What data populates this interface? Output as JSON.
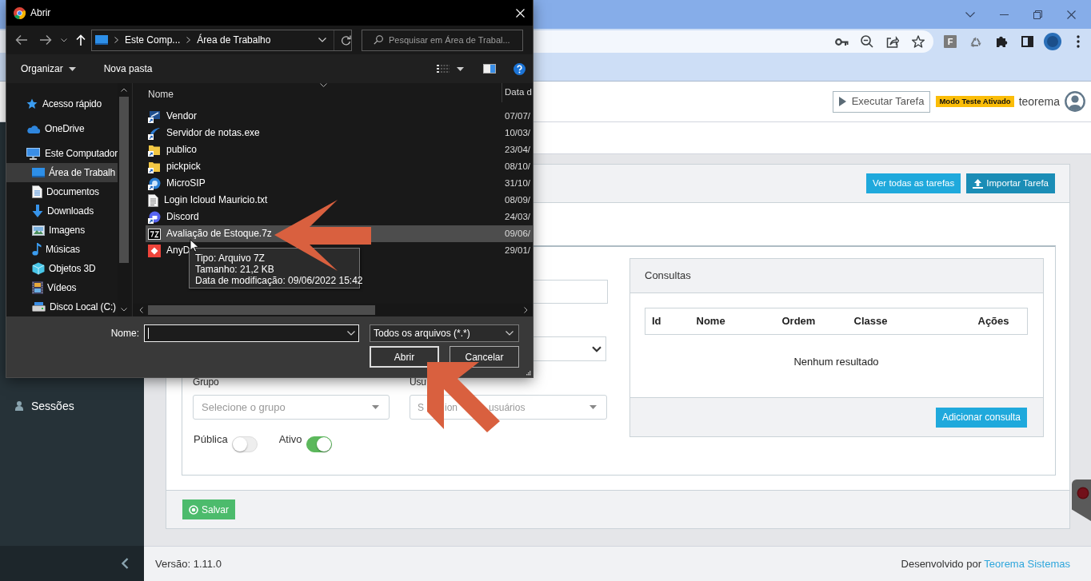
{
  "browser": {
    "extension_label": "F"
  },
  "dialog": {
    "title": "Abrir",
    "breadcrumb": [
      "Este Comp...",
      "Área de Trabalho"
    ],
    "search": {
      "placeholder": "Pesquisar em Área de Trabal..."
    },
    "commands": [
      {
        "label": "Organizar",
        "kind": "menu"
      },
      {
        "label": "Nova pasta",
        "kind": "button"
      }
    ],
    "nav_pane": {
      "items": [
        {
          "label": "Acesso rápido",
          "selected": false
        },
        {
          "label": "OneDrive",
          "selected": false
        },
        {
          "label": "Este Computador",
          "selected": false,
          "children": [
            {
              "label": "Área de Trabalh",
              "selected": true
            },
            {
              "label": "Documentos",
              "selected": false
            },
            {
              "label": "Downloads",
              "selected": false
            },
            {
              "label": "Imagens",
              "selected": false
            },
            {
              "label": "Músicas",
              "selected": false
            },
            {
              "label": "Objetos 3D",
              "selected": false
            },
            {
              "label": "Vídeos",
              "selected": false
            },
            {
              "label": "Disco Local (C:)",
              "selected": false
            }
          ]
        }
      ]
    },
    "columns": [
      "Nome",
      "Data d"
    ],
    "files": [
      {
        "name": "Vendor",
        "date": "07/07/",
        "hovered": false
      },
      {
        "name": "Servidor de notas.exe",
        "date": "10/03/",
        "hovered": false
      },
      {
        "name": "publico",
        "date": "23/04/",
        "hovered": false
      },
      {
        "name": "pickpick",
        "date": "08/10/",
        "hovered": false
      },
      {
        "name": "MicroSIP",
        "date": "31/10/",
        "hovered": false
      },
      {
        "name": "Login Icloud Mauricio.txt",
        "date": "08/09/",
        "hovered": false
      },
      {
        "name": "Discord",
        "date": "24/03/",
        "hovered": false
      },
      {
        "name": "Avaliação de Estoque.7z",
        "date": "09/06/",
        "hovered": true
      },
      {
        "name": "AnyD",
        "date": "29/01/",
        "hovered": false
      }
    ],
    "tooltip": [
      "Tipo: Arquivo 7Z",
      "Tamanho: 21,2 KB",
      "Data de modificação: 09/06/2022 15:42"
    ],
    "file_name": {
      "label": "Nome:"
    },
    "file_type": {
      "value": "Todos os arquivos (*.*)"
    },
    "buttons": [
      {
        "label": "Abrir",
        "default": true
      },
      {
        "label": "Cancelar",
        "default": false
      }
    ]
  },
  "page": {
    "header": {
      "run_button": "Executar Tarefa",
      "test_mode_badge": "Modo Teste Ativado",
      "user_name": "teorema"
    },
    "sidebar": {
      "items": [
        {
          "label": "Sessões"
        }
      ]
    },
    "card": {
      "header_buttons": [
        {
          "label": "Ver todas as tarefas",
          "kind": "plain"
        },
        {
          "label": "Importar Tarefa",
          "kind": "upload"
        }
      ],
      "form": {
        "fields": [
          {
            "label": "Grupo",
            "placeholder": "Selecione o grupo"
          },
          {
            "label": "Usu",
            "placeholder_parts": [
              "S",
              "ion",
              "usuários"
            ]
          }
        ],
        "toggles": [
          {
            "label": "Pública",
            "on": false
          },
          {
            "label": "Ativo",
            "on": true
          }
        ]
      },
      "consultas": {
        "title": "Consultas",
        "columns": [
          "Id",
          "Nome",
          "Ordem",
          "Classe",
          "Ações"
        ],
        "empty_text": "Nenhum resultado",
        "add_button": "Adicionar consulta"
      },
      "save_button": "Salvar"
    },
    "footer": {
      "version": "Versão: 1.11.0",
      "credit": "Desenvolvido por",
      "credit_link": "Teorema Sistemas"
    }
  }
}
